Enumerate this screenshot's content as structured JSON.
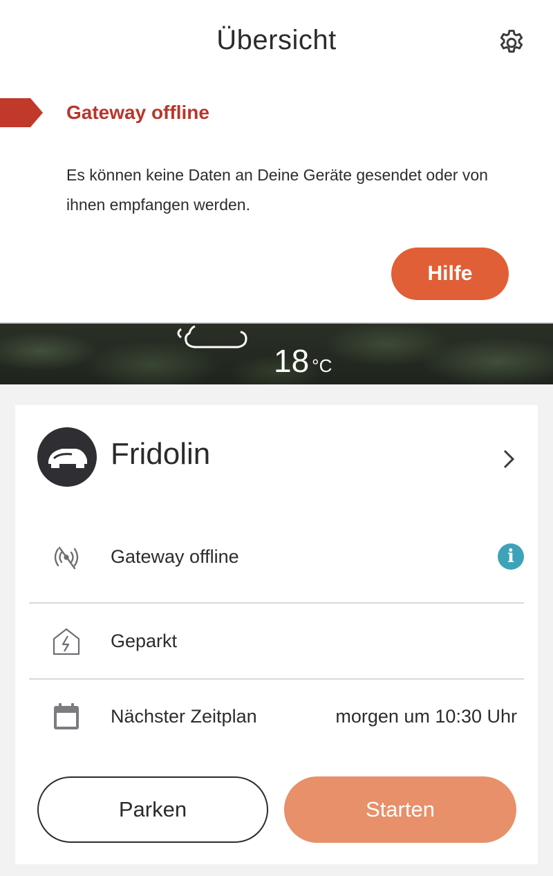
{
  "header": {
    "title": "Übersicht",
    "settings_icon": "gear-icon"
  },
  "banner": {
    "title": "Gateway offline",
    "message": "Es können keine Daten an Deine Geräte gesendet oder von ihnen empfangen werden.",
    "help_label": "Hilfe",
    "accent_color": "#b8362c",
    "button_color": "#e05f36"
  },
  "weather": {
    "icon": "cloud-icon",
    "temperature": "18",
    "unit": "°C"
  },
  "device": {
    "name": "Fridolin",
    "avatar_icon": "robot-mower-icon",
    "status_rows": [
      {
        "icon": "signal-off-icon",
        "label": "Gateway offline",
        "value": "",
        "info_icon": "info-icon"
      },
      {
        "icon": "charging-station-icon",
        "label": "Geparkt",
        "value": ""
      },
      {
        "icon": "calendar-icon",
        "label": "Nächster Zeitplan",
        "value": "morgen um 10:30 Uhr"
      }
    ],
    "park_label": "Parken",
    "start_label": "Starten",
    "start_color": "#e79069",
    "info_color": "#3da3b8"
  }
}
